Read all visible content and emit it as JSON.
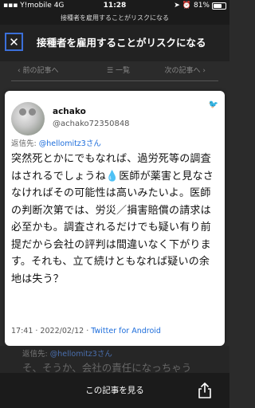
{
  "status_bar": {
    "carrier": "Y!mobile",
    "network": "4G",
    "time": "11:28",
    "battery": "81%",
    "battery_level": 0.81
  },
  "url_bar": {
    "title": "接種者を雇用することがリスクになる"
  },
  "header": {
    "title": "接種者を雇用することがリスクになる",
    "close_icon": "close-icon"
  },
  "nav": {
    "prev": "前の記事へ",
    "list": "一覧",
    "next": "次の記事へ"
  },
  "tweet": {
    "display_name": "achako",
    "handle": "@achako72350848",
    "reply_prefix": "返信先: ",
    "reply_to": "@hellomitz3さん",
    "body_part1": "突然死とかにでもなれば、過労死等の調査はされるでしょうね",
    "body_part2": "医師が薬害と見なさなければその可能性は高いみたいよ。医師の判断次第では、労災／損害賠償の請求は必至かも。調査されるだけでも疑い有り前提だから会社の評判は間違いなく下がります。それも、立て続けともなれば疑いの余地は失う？",
    "timestamp": "17:41 · 2022/02/12 · ",
    "source": "Twitter for Android"
  },
  "next_tweet": {
    "reply_prefix": "返信先: ",
    "reply_to": "@hellomitz3さん",
    "text": "そ、そうか、会社の責任になっちゃう"
  },
  "bottom_bar": {
    "view_article": "この記事を見る",
    "share_icon": "share-icon"
  }
}
